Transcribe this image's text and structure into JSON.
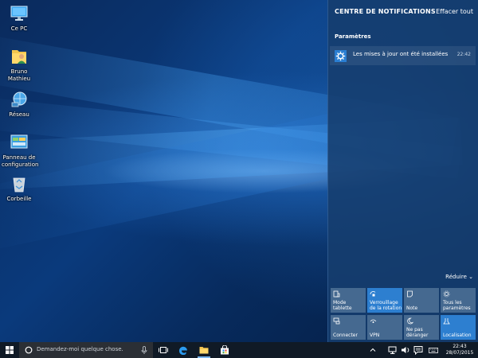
{
  "desktop": {
    "icons": [
      {
        "label": "Ce PC",
        "icon": "computer-icon"
      },
      {
        "label": "Bruno Mathieu",
        "icon": "user-folder-icon"
      },
      {
        "label": "Réseau",
        "icon": "network-icon"
      },
      {
        "label": "Panneau de configuration",
        "icon": "control-panel-icon"
      },
      {
        "label": "Corbeille",
        "icon": "recycle-bin-icon"
      }
    ]
  },
  "action_center": {
    "title": "CENTRE DE NOTIFICATIONS",
    "clear_all": "Effacer tout",
    "group_title": "Paramètres",
    "notification": {
      "icon": "gear-icon",
      "text": "Les mises à jour ont été installées",
      "time": "22:42"
    },
    "collapse_label": "Réduire",
    "collapse_icon": "chevron-down-icon",
    "quick_actions": [
      {
        "label": "Mode tablette",
        "icon": "tablet-mode-icon",
        "active": false
      },
      {
        "label": "Verrouillage de la rotation",
        "icon": "rotation-lock-icon",
        "active": true
      },
      {
        "label": "Note",
        "icon": "note-icon",
        "active": false
      },
      {
        "label": "Tous les paramètres",
        "icon": "settings-icon",
        "active": false
      },
      {
        "label": "Connecter",
        "icon": "connect-icon",
        "active": false
      },
      {
        "label": "VPN",
        "icon": "vpn-icon",
        "active": false
      },
      {
        "label": "Ne pas déranger",
        "icon": "moon-icon",
        "active": false
      },
      {
        "label": "Localisation",
        "icon": "location-icon",
        "active": true
      }
    ]
  },
  "taskbar": {
    "start_icon": "windows-logo-icon",
    "search_placeholder": "Demandez-moi quelque chose.",
    "search_icon": "cortana-icon",
    "mic_icon": "microphone-icon",
    "buttons": [
      {
        "name": "task-view-icon"
      },
      {
        "name": "edge-icon"
      },
      {
        "name": "file-explorer-icon"
      },
      {
        "name": "store-icon"
      }
    ],
    "tray_icons": [
      "chevron-up-icon",
      "network-icon",
      "volume-icon",
      "action-center-icon",
      "keyboard-icon"
    ],
    "clock": {
      "time": "22:43",
      "date": "28/07/2015"
    }
  },
  "colors": {
    "accent": "#2d7fd0",
    "tile": "#486c92",
    "taskbar": "#101a26"
  }
}
